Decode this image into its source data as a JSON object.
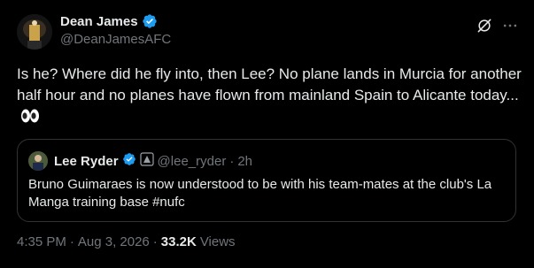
{
  "author": {
    "display_name": "Dean James",
    "handle": "@DeanJamesAFC"
  },
  "tweet": {
    "text": "Is he? Where did he fly into, then Lee? No plane lands in Murcia for another half hour and no planes have flown from mainland Spain to Alicante today...",
    "emoji": "eyes-emoji"
  },
  "quote": {
    "display_name": "Lee Ryder",
    "handle": "@lee_ryder",
    "separator": "·",
    "time": "2h",
    "text": "Bruno Guimaraes is now understood to be with his team-mates at the club's La Manga training base #nufc"
  },
  "meta": {
    "time": "4:35 PM",
    "separator": "·",
    "date": "Aug 3, 2026",
    "separator2": "·",
    "views_count": "33.2K",
    "views_label": "Views"
  },
  "icons": {
    "verified": "verified-badge-icon",
    "grok": "grok-icon",
    "more": "more-icon",
    "affiliate": "affiliate-badge-icon"
  },
  "colors": {
    "background": "#000000",
    "text": "#e7e9ea",
    "secondary_text": "#71767b",
    "verified_blue": "#1d9bf0",
    "border": "#2f3336"
  }
}
